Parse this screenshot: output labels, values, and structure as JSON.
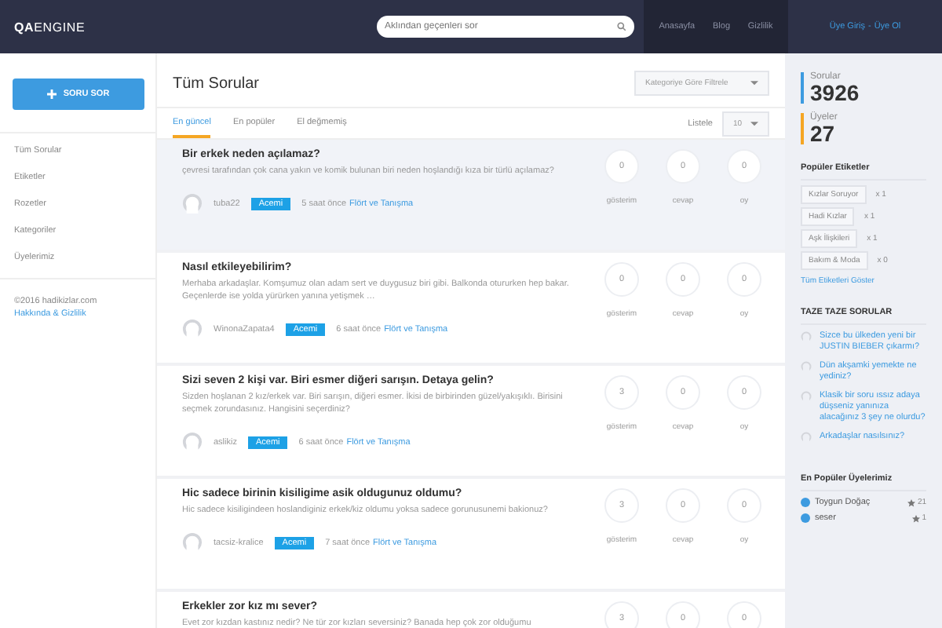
{
  "header": {
    "logo": "**QA**ENGINE",
    "search": {
      "placeholder": "Aklından geçenleri sor"
    },
    "nav": [
      "Anasayfa",
      "Blog",
      "Gizlilik"
    ],
    "auth": {
      "login": "Üye Giriş",
      "separator": "-",
      "signup": "Üye Ol"
    }
  },
  "sidebar": {
    "ask_button": "SORU SOR",
    "items": [
      "Tüm Sorular",
      "Etiketler",
      "Rozetler",
      "Kategoriler",
      "Üyelerimiz"
    ],
    "copyright": "©2016 hadikizlar.com",
    "about_link": "Hakkında & Gizlilik"
  },
  "main": {
    "title": "Tüm Sorular",
    "category_filter": "Kategoriye Göre Filtrele",
    "tabs": [
      {
        "label": "En güncel",
        "selected": true
      },
      {
        "label": "En popüler",
        "selected": false
      },
      {
        "label": "El değmemiş",
        "selected": false
      }
    ],
    "page_size": {
      "label": "Listele",
      "value": "10"
    },
    "questions": [
      {
        "title": "Bir erkek neden açılamaz?",
        "body": "çevresi tarafından çok cana yakın ve komik bulunan biri neden hoşlandığı kıza bir türlü açılamaz?",
        "user": "tuba22",
        "badge": "Acemi",
        "time": "5 saat önce",
        "category": "Flört ve Tanışma",
        "highlighted": true,
        "stats": [
          {
            "value": "0",
            "label": "gösterim"
          },
          {
            "value": "0",
            "label": "cevap"
          },
          {
            "value": "0",
            "label": "oy"
          }
        ]
      },
      {
        "title": "Nasıl etkileyebilirim?",
        "body": "Merhaba arkadaşlar. Komşumuz olan adam sert ve duygusuz biri gibi. Balkonda otururken hep bakar. Geçenlerde ise yolda yürürken yanına yetişmek …",
        "user": "WinonaZapata4",
        "badge": "Acemi",
        "time": "6 saat önce",
        "category": "Flört ve Tanışma",
        "highlighted": false,
        "stats": [
          {
            "value": "0",
            "label": "gösterim"
          },
          {
            "value": "0",
            "label": "cevap"
          },
          {
            "value": "0",
            "label": "oy"
          }
        ]
      },
      {
        "title": "Sizi seven 2 kişi var. Biri esmer diğeri sarışın. Detaya gelin?",
        "body": "Sizden hoşlanan 2 kız/erkek var. Biri sarışın, diğeri esmer. İkisi de birbirinden güzel/yakışıklı. Birisini seçmek zorundasınız. Hangisini seçerdiniz?",
        "user": "aslikiz",
        "badge": "Acemi",
        "time": "6 saat önce",
        "category": "Flört ve Tanışma",
        "highlighted": false,
        "stats": [
          {
            "value": "3",
            "label": "gösterim"
          },
          {
            "value": "0",
            "label": "cevap"
          },
          {
            "value": "0",
            "label": "oy"
          }
        ]
      },
      {
        "title": "Hic sadece birinin kisiligime asik oldugunuz oldumu?",
        "body": "Hic sadece kisiligindeen hoslandiginiz erkek/kiz oldumu yoksa sadece gorunusunemi bakionuz?",
        "user": "tacsiz-kralice",
        "badge": "Acemi",
        "time": "7 saat önce",
        "category": "Flört ve Tanışma",
        "highlighted": false,
        "stats": [
          {
            "value": "3",
            "label": "gösterim"
          },
          {
            "value": "0",
            "label": "cevap"
          },
          {
            "value": "0",
            "label": "oy"
          }
        ]
      },
      {
        "title": "Erkekler zor kız mı sever?",
        "body": "Evet zor kızdan kastınız nedir? Ne tür zor kızları seversiniz? Banada hep çok zor olduğumu",
        "highlighted": false,
        "stats": [
          {
            "value": "3"
          },
          {
            "value": "0"
          },
          {
            "value": "0"
          }
        ]
      }
    ]
  },
  "right": {
    "stats": [
      {
        "label": "Sorular",
        "value": "3926",
        "color": "#3d9be0"
      },
      {
        "label": "Üyeler",
        "value": "27",
        "color": "#f5a623"
      }
    ],
    "popular_tags": {
      "title": "Popüler Etiketler",
      "tags": [
        {
          "name": "Kızlar Soruyor",
          "count": "x 1"
        },
        {
          "name": "Hadi Kızlar",
          "count": "x 1"
        },
        {
          "name": "Aşk İlişkileri",
          "count": "x 1"
        },
        {
          "name": "Bakım & Moda",
          "count": "x 0"
        }
      ],
      "show_all": "Tüm Etiketleri Göster"
    },
    "fresh": {
      "title": "TAZE TAZE SORULAR",
      "items": [
        "Sizce bu ülkeden yeni bir JUSTIN BIEBER çıkarmı?",
        "Dün akşamki yemekte ne yediniz?",
        "Klasik bir soru ıssız adaya düşseniz yanınıza alacağınız 3 şey ne olurdu?",
        "Arkadaşlar nasılsınız?"
      ]
    },
    "top_members": {
      "title": "En Popüler Üyelerimiz",
      "members": [
        {
          "name": "Toygun Doğaç",
          "points": "21"
        },
        {
          "name": "seser",
          "points": "1"
        }
      ]
    }
  }
}
